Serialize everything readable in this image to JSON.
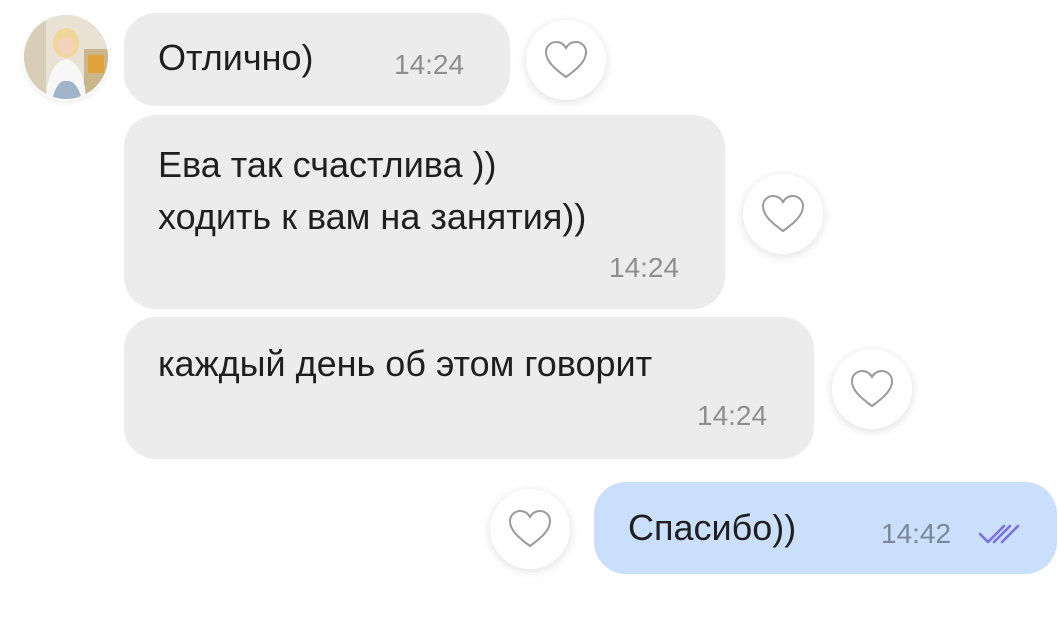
{
  "messages": [
    {
      "text": "Отлично)",
      "time": "14:24",
      "direction": "incoming"
    },
    {
      "lines": [
        "Ева так счастлива ))",
        "ходить к вам на занятия))"
      ],
      "time": "14:24",
      "direction": "incoming"
    },
    {
      "text": "каждый день об этом говорит",
      "time": "14:24",
      "direction": "incoming"
    },
    {
      "text": "Спасибо))",
      "time": "14:42",
      "direction": "outgoing",
      "status_icon": "double-check-icon"
    }
  ],
  "icons": {
    "reaction": "heart-outline-icon",
    "read_status": "double-check-icon"
  },
  "colors": {
    "incoming_bubble": "#ececec",
    "outgoing_bubble": "#c9dffb",
    "read_ticks": "#7a6ee0",
    "timestamp": "#8e8e8e"
  }
}
